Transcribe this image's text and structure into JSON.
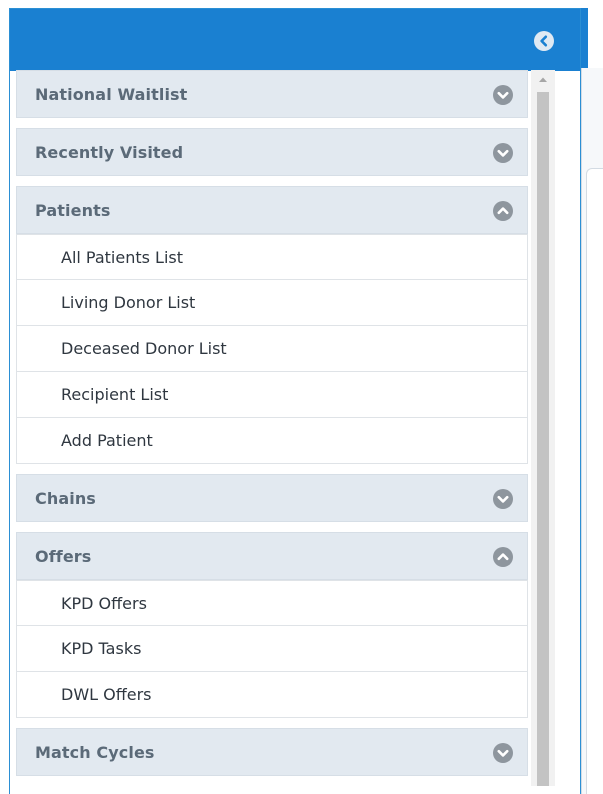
{
  "sidebar": {
    "sections": [
      {
        "title": "National Waitlist",
        "expanded": false,
        "items": []
      },
      {
        "title": "Recently Visited",
        "expanded": false,
        "items": []
      },
      {
        "title": "Patients",
        "expanded": true,
        "items": [
          {
            "label": "All Patients List"
          },
          {
            "label": "Living Donor List"
          },
          {
            "label": "Deceased Donor List"
          },
          {
            "label": "Recipient List"
          },
          {
            "label": "Add Patient"
          }
        ]
      },
      {
        "title": "Chains",
        "expanded": false,
        "items": []
      },
      {
        "title": "Offers",
        "expanded": true,
        "items": [
          {
            "label": "KPD Offers"
          },
          {
            "label": "KPD Tasks"
          },
          {
            "label": "DWL Offers"
          }
        ]
      },
      {
        "title": "Match Cycles",
        "expanded": false,
        "items": []
      }
    ]
  },
  "icons": {
    "collapse": "chevron-left-circle-icon",
    "expand": "chevron-down-circle-icon",
    "collapse_section": "chevron-up-circle-icon"
  },
  "colors": {
    "header": "#1a80d1",
    "section_bg": "#e2e9f0",
    "section_text": "#5b6a78",
    "item_text": "#2f3740",
    "chevron": "#8e969e"
  }
}
